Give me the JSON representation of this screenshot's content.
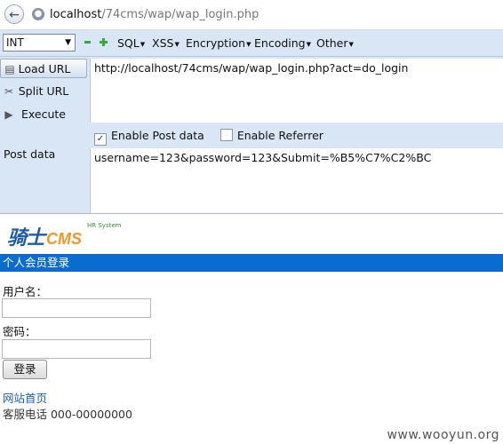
{
  "browser": {
    "url_host": "localhost",
    "url_path": "/74cms/wap/wap_login.php"
  },
  "hackbar": {
    "select_value": "INT",
    "menus": [
      "SQL",
      "XSS",
      "Encryption",
      "Encoding",
      "Other"
    ],
    "buttons": {
      "load": "Load URL",
      "split": "Split URL",
      "execute": "Execute"
    },
    "url_value": "http://localhost/74cms/wap/wap_login.php?act=do_login",
    "enable_post_label": "Enable Post data",
    "enable_post_checked": true,
    "enable_referrer_label": "Enable Referrer",
    "enable_referrer_checked": false,
    "post_data_label": "Post data",
    "post_data_value": "username=123&password=123&Submit=%B5%C7%C2%BC"
  },
  "page": {
    "logo_cn": "骑士",
    "logo_cms": "CMS",
    "logo_sub": "HR System",
    "header_title": "个人会员登录",
    "username_label": "用户名：",
    "password_label": "密码：",
    "submit_label": "登录",
    "home_link": "网站首页",
    "service_phone": "客服电话 000-00000000"
  },
  "watermark": "www.wooyun.org",
  "colors": {
    "accent_bar": "#0a6bd0",
    "toolbar_bg": "#d9e6f5",
    "link": "#1a5fb0"
  }
}
